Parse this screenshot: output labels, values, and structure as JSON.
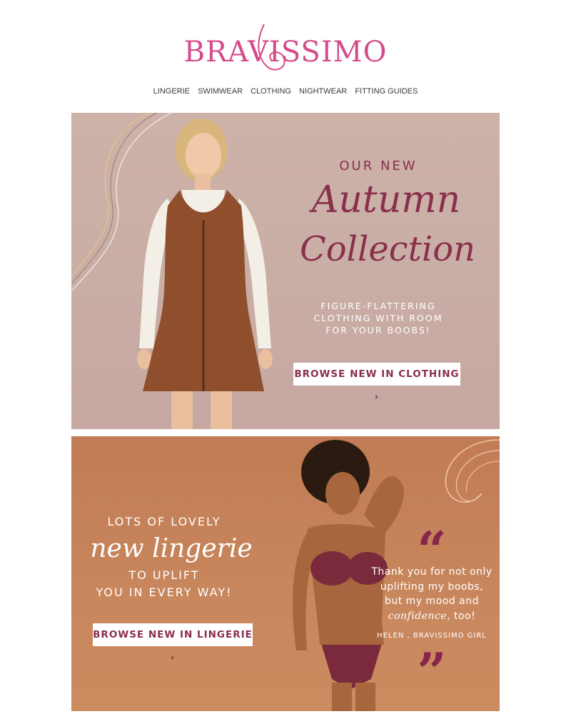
{
  "brand": {
    "logo_text": "BRAVISSIMO",
    "accent_color": "#d44b8b"
  },
  "nav": {
    "items": [
      "LINGERIE",
      "SWIMWEAR",
      "CLOTHING",
      "NIGHTWEAR",
      "FITTING GUIDES"
    ]
  },
  "hero_autumn": {
    "eyebrow": "OUR NEW",
    "script_line1": "Autumn",
    "script_line2": "Collection",
    "subtitle_line1": "FIGURE-FLATTERING",
    "subtitle_line2": "CLOTHING WITH ROOM",
    "subtitle_line3": "FOR YOUR BOOBS!",
    "button_label": "BROWSE NEW IN CLOTHING ›",
    "bg_color": "#c9aea6",
    "text_color": "#8a2f4c"
  },
  "hero_lingerie": {
    "eyebrow": "LOTS OF LOVELY",
    "script_line": "new lingerie",
    "line2": "TO UPLIFT",
    "line3": "YOU IN EVERY WAY!",
    "button_label": "BROWSE NEW IN LINGERIE ›",
    "bg_color": "#c8875d",
    "quote": {
      "open_mark": "“",
      "text_part1": "Thank you for not only uplifting my boobs, but my mood and ",
      "text_emphasis": "confidence",
      "text_part2": ", too!",
      "author": "HELEN , BRAVISSIMO GIRL",
      "close_mark": "”",
      "mark_color": "#86264a"
    }
  }
}
